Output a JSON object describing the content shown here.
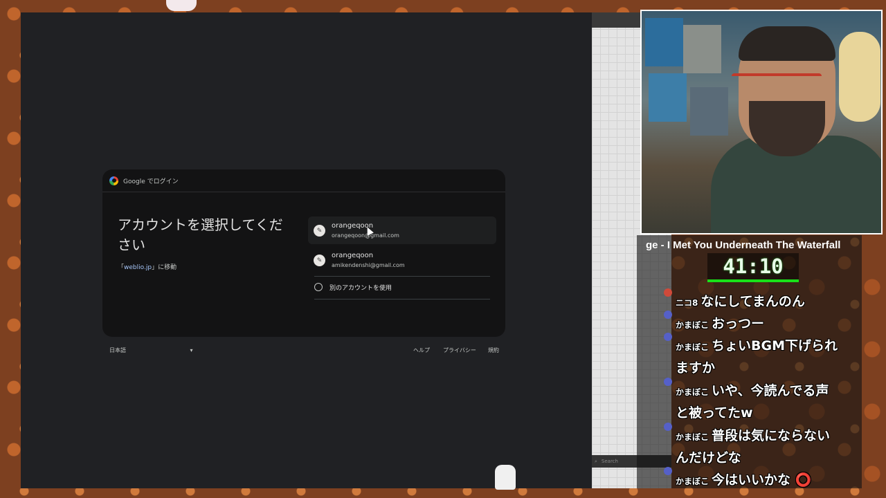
{
  "dialog": {
    "header_title": "Google でログイン",
    "heading": "アカウントを選択してください",
    "goto_prefix": "「",
    "goto_link": "weblio.jp",
    "goto_suffix": "」に移動",
    "accounts": [
      {
        "name": "orangeqoon",
        "email": "orangeqoon@gmail.com"
      },
      {
        "name": "orangeqoon",
        "email": "amikendenshi@gmail.com"
      }
    ],
    "use_another": "別のアカウントを使用"
  },
  "footer": {
    "language": "日本語",
    "help": "ヘルプ",
    "privacy": "プライバシー",
    "terms": "規約"
  },
  "editor": {
    "search_placeholder": "Search"
  },
  "stream": {
    "song": "ge - I Met You Underneath The Waterfall",
    "timer": "41:10",
    "timer_progress": 1.0
  },
  "chat": [
    {
      "user": "ニコ8",
      "msg": "なにしてまんのん"
    },
    {
      "user": "かまぼこ",
      "msg": "おっつー"
    },
    {
      "user": "かまぼこ",
      "msg": "ちょいBGM下げられ",
      "cont": "ますか"
    },
    {
      "user": "かまぼこ",
      "msg": "いや、今読んでる声",
      "cont": "と被ってたw"
    },
    {
      "user": "かまぼこ",
      "msg": "普段は気にならない",
      "cont": "んだけどな"
    },
    {
      "user": "かまぼこ",
      "msg": "今はいいかな ⭕"
    }
  ]
}
